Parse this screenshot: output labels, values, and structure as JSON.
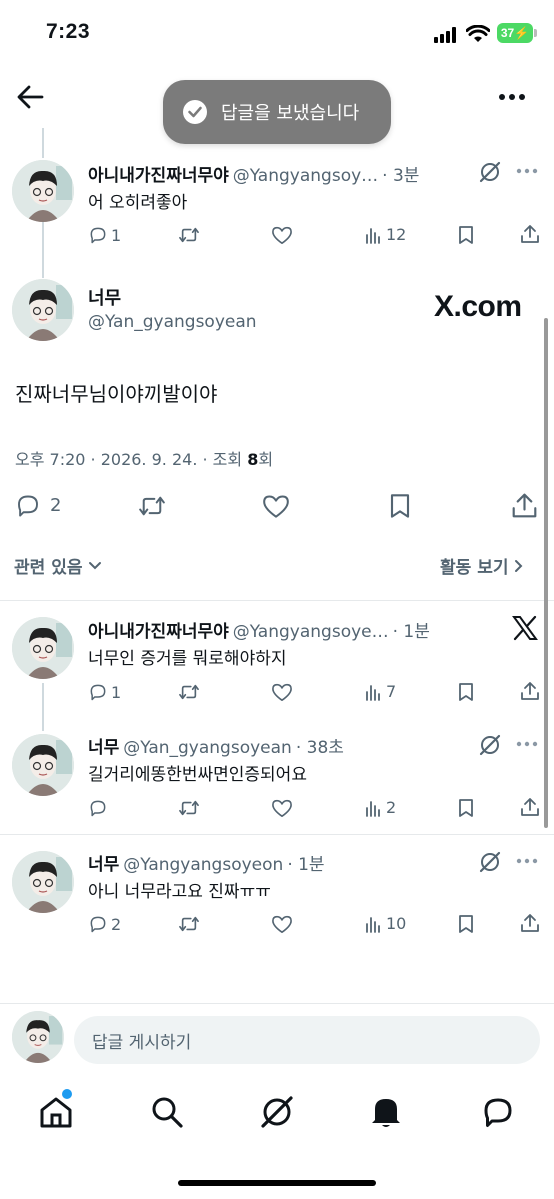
{
  "status_bar": {
    "time": "7:23",
    "battery": "37"
  },
  "toast": {
    "text": "답글을 보냈습니다"
  },
  "tweets_above": [
    {
      "name": "아니내가진짜너무야",
      "handle": "@Yangyangsoy…",
      "time": "· 3분",
      "text": "어 오히려좋아",
      "replies": "1",
      "retweets": "",
      "likes": "",
      "views": "12"
    }
  ],
  "main_tweet": {
    "name": "너무",
    "handle": "@Yan_gyangsoyean",
    "watermark": "X.com",
    "text": "진짜너무님이야끼발이야",
    "meta_prefix": "오후 7:20 · 2026. 9. 24. · 조회 ",
    "views": "8",
    "meta_suffix": "회",
    "replies": "2"
  },
  "relevance": {
    "left": "관련 있음",
    "right": "활동 보기"
  },
  "replies": [
    {
      "name": "아니내가진짜너무야",
      "handle": "@Yangyangsoye…",
      "time": "· 1분",
      "text": "너무인 증거를 뭐로해야하지",
      "replies": "1",
      "views": "7"
    },
    {
      "name": "너무",
      "handle": "@Yan_gyangsoyean",
      "time": "· 38초",
      "text": "길거리에똥한번싸면인증되어요",
      "replies": "",
      "views": "2"
    },
    {
      "name": "너무",
      "handle": "@Yangyangsoyeon",
      "time": "· 1분",
      "text": "아니 너무라고요 진짜ㅠㅠ",
      "replies": "2",
      "views": "10"
    }
  ],
  "reply_composer": {
    "placeholder": "답글 게시하기"
  },
  "tab_bar": [
    "home-icon",
    "search-icon",
    "grok-icon",
    "notifications-icon",
    "messages-icon"
  ]
}
